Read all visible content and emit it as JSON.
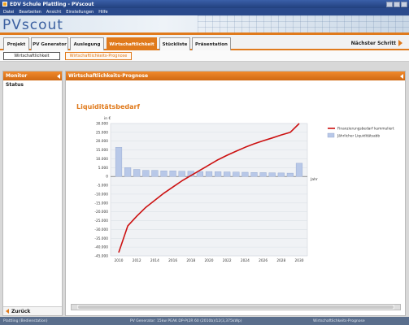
{
  "window": {
    "title": "EDV Schule Plattling - PVscout"
  },
  "menu": [
    "Datei",
    "Bearbeiten",
    "Ansicht",
    "Einstellungen",
    "Hilfe"
  ],
  "brand": "PVscout",
  "tabs": [
    "Projekt",
    "PV Generator",
    "Auslegung",
    "Wirtschaftlichkeit",
    "Stückliste",
    "Präsentation"
  ],
  "active_tab": "Wirtschaftlichkeit",
  "next_step": "Nächster Schritt",
  "subtabs": [
    "Wirtschaftlichkeit",
    "Wirtschaftlichkeits-Prognose"
  ],
  "left_panel": {
    "title": "Monitor",
    "status": "Status",
    "back": "Zurück"
  },
  "main_panel": {
    "title": "Wirtschaftlichkeits-Prognose"
  },
  "statusbar": {
    "left": "Plattling (Bedienstation)",
    "middle": "PV Generator: 15kw PEAK DP-P(2R 60 (2010b)/12(3,375kWp)",
    "right": "Wirtschaftlichkeits-Prognose"
  },
  "colors": {
    "accent": "#e07a1c",
    "line": "#cc1111",
    "bar": "#b8c8e8"
  },
  "chart_data": {
    "type": "bar+line",
    "title": "Liquiditätsbedarf",
    "ylabel": "in €",
    "xlabel": "Jahr",
    "ylim": [
      -45000,
      30000
    ],
    "yticks": [
      "30.000",
      "25.000",
      "20.000",
      "15.000",
      "10.000",
      "5.000",
      "0",
      "-5.000",
      "-10.000",
      "-15.000",
      "-20.000",
      "-25.000",
      "-30.000",
      "-35.000",
      "-40.000",
      "-45.000"
    ],
    "x": [
      2010,
      2011,
      2012,
      2013,
      2014,
      2015,
      2016,
      2017,
      2018,
      2019,
      2020,
      2021,
      2022,
      2023,
      2024,
      2025,
      2026,
      2027,
      2028,
      2029,
      2030
    ],
    "xticks": [
      "2010",
      "2012",
      "2014",
      "2016",
      "2018",
      "2020",
      "2022",
      "2024",
      "2026",
      "2028",
      "2030"
    ],
    "series": [
      {
        "name": "Finanzierungsbedarf kummuliert",
        "kind": "line",
        "values": [
          -43000,
          -28000,
          -22500,
          -17500,
          -13500,
          -9500,
          -6000,
          -2500,
          500,
          3500,
          6500,
          9500,
          12000,
          14300,
          16500,
          18500,
          20200,
          21800,
          23500,
          25000,
          30000
        ]
      },
      {
        "name": "Jährlicher Liquiditätsabb",
        "kind": "bar",
        "values": [
          16500,
          5000,
          4000,
          3500,
          3500,
          3200,
          3200,
          3000,
          3000,
          2800,
          2800,
          2700,
          2600,
          2500,
          2400,
          2300,
          2200,
          2100,
          2000,
          1900,
          7500
        ]
      }
    ]
  }
}
